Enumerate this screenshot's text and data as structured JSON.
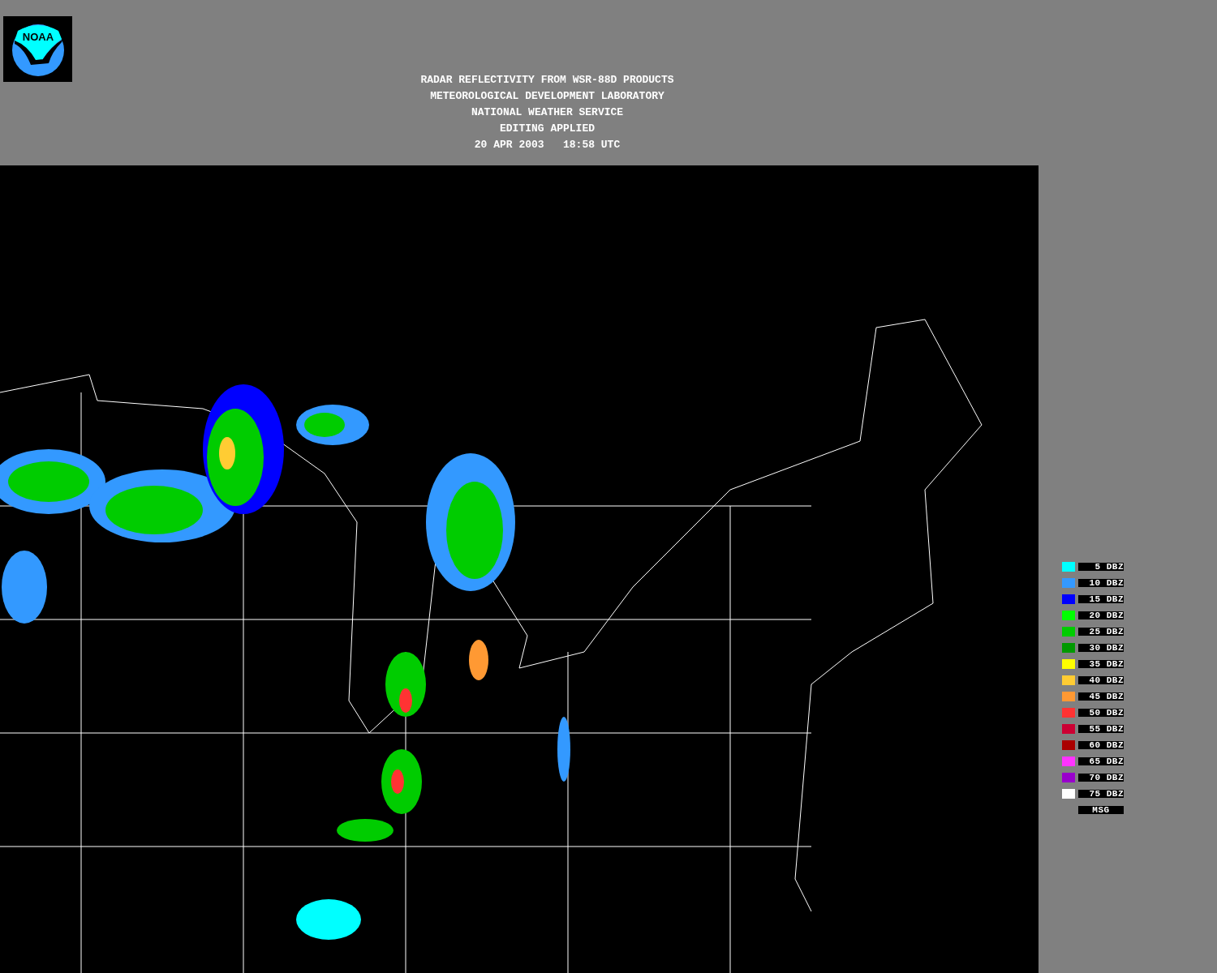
{
  "logo": {
    "text": "NOAA"
  },
  "title_lines": [
    "RADAR REFLECTIVITY FROM WSR-88D PRODUCTS",
    "METEOROLOGICAL DEVELOPMENT LABORATORY",
    "NATIONAL WEATHER SERVICE",
    "EDITING APPLIED",
    "20 APR 2003   18:58 UTC"
  ],
  "legend": [
    {
      "kind": "swatch",
      "color": "#00ffff",
      "label": "5 DBZ"
    },
    {
      "kind": "swatch",
      "color": "#3399ff",
      "label": "10 DBZ"
    },
    {
      "kind": "swatch",
      "color": "#0000ff",
      "label": "15 DBZ"
    },
    {
      "kind": "swatch",
      "color": "#00ff00",
      "label": "20 DBZ"
    },
    {
      "kind": "swatch",
      "color": "#00cc00",
      "label": "25 DBZ"
    },
    {
      "kind": "swatch",
      "color": "#009900",
      "label": "30 DBZ"
    },
    {
      "kind": "swatch",
      "color": "#ffff00",
      "label": "35 DBZ"
    },
    {
      "kind": "swatch",
      "color": "#ffcc33",
      "label": "40 DBZ"
    },
    {
      "kind": "swatch",
      "color": "#ff9933",
      "label": "45 DBZ"
    },
    {
      "kind": "swatch",
      "color": "#ff3333",
      "label": "50 DBZ"
    },
    {
      "kind": "swatch",
      "color": "#cc0033",
      "label": "55 DBZ"
    },
    {
      "kind": "swatch",
      "color": "#aa0000",
      "label": "60 DBZ"
    },
    {
      "kind": "swatch",
      "color": "#ff33ff",
      "label": "65 DBZ"
    },
    {
      "kind": "swatch",
      "color": "#9900cc",
      "label": "70 DBZ"
    },
    {
      "kind": "swatch",
      "color": "#ffffff",
      "label": "75 DBZ"
    },
    {
      "kind": "plain",
      "label": "MSG"
    }
  ]
}
